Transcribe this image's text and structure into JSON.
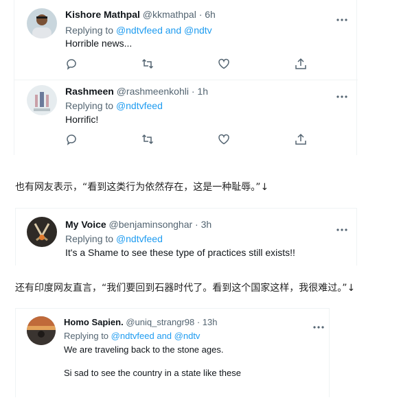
{
  "tweets": [
    {
      "name": "Kishore Mathpal",
      "handle": "@kkmathpal · 6h",
      "replying_prefix": "Replying to ",
      "mention1": "@ndtvfeed",
      "conj": " and ",
      "mention2": "@ndtv",
      "text": "Horrible news..."
    },
    {
      "name": "Rashmeen",
      "handle": "@rashmeenkohli · 1h",
      "replying_prefix": "Replying to ",
      "mention1": "@ndtvfeed",
      "text": "Horrific!"
    },
    {
      "name": "My Voice",
      "handle": "@benjaminsonghar · 3h",
      "replying_prefix": "Replying to ",
      "mention1": "@ndtvfeed",
      "text": "It's a Shame to see these type of practices still exists!!"
    },
    {
      "name": "Homo Sapien.",
      "handle": "@uniq_strangr98 · 13h",
      "replying_prefix": "Replying to ",
      "mention1": "@ndtvfeed",
      "conj": " and ",
      "mention2": "@ndtv",
      "text": "We are traveling back to the stone ages.",
      "text2": "Si sad to see the country in a state like these"
    }
  ],
  "captions": {
    "first": "也有网友表示，“看到这类行为依然存在，这是一种耻辱。”↓",
    "second": "还有印度网友直言，“我们要回到石器时代了。看到这个国家这样，我很难过。”↓"
  },
  "icons": [
    "reply-icon",
    "retweet-icon",
    "like-icon",
    "share-icon",
    "more-icon"
  ],
  "colors": {
    "link": "#1d9bf0",
    "secondary_text": "#536471",
    "divider": "#eff3f4"
  }
}
